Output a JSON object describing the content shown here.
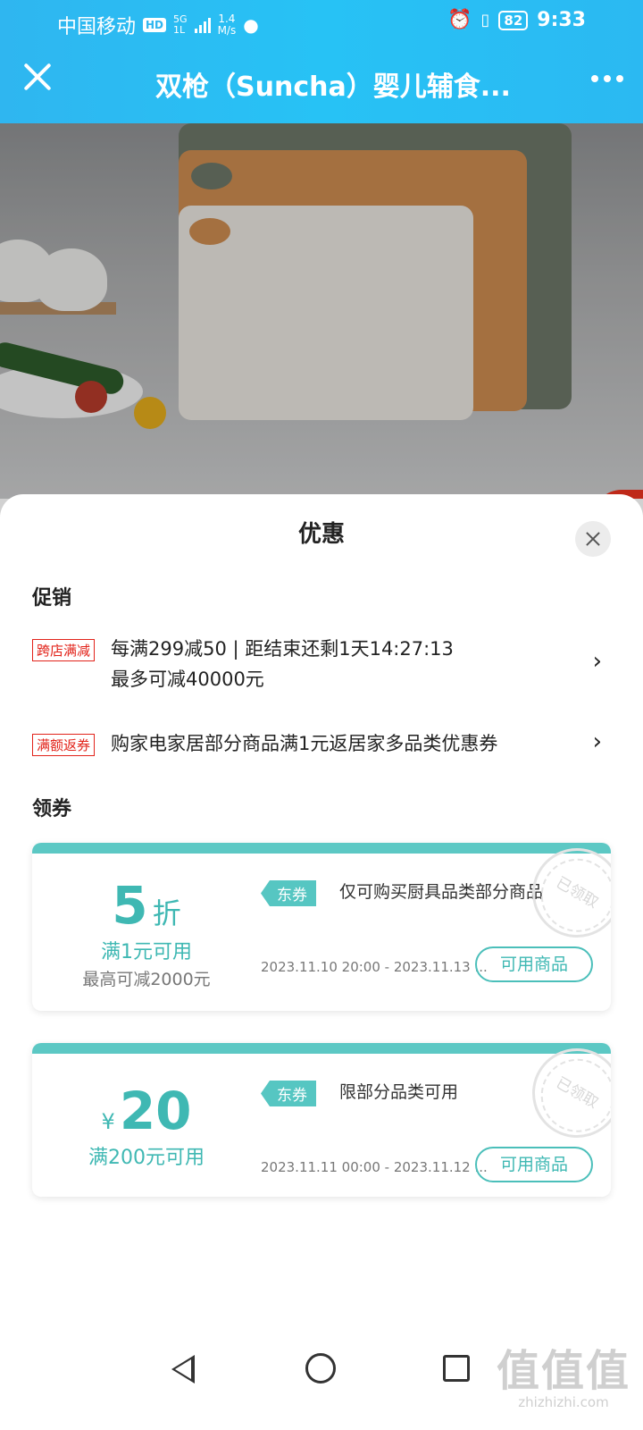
{
  "status_bar": {
    "carrier": "中国移动",
    "hd": "HD",
    "network_top": "5G",
    "network_bottom": "1L",
    "speed_value": "1.4",
    "speed_unit": "M/s",
    "battery": "82",
    "time": "9:33"
  },
  "header": {
    "title": "双枪（Suncha）婴儿辅食..."
  },
  "sheet": {
    "title": "优惠",
    "promotions_label": "促销",
    "promotions": [
      {
        "tag": "跨店满减",
        "line1": "每满299减50 | 距结束还剩1天14:27:13",
        "line2": "最多可减40000元"
      },
      {
        "tag": "满额返券",
        "line1": "购家电家居部分商品满1元返居家多品类优惠券"
      }
    ],
    "coupons_label": "领券",
    "coupons": [
      {
        "value": "5",
        "unit": "折",
        "condition": "满1元可用",
        "max_discount": "最高可减2000元",
        "tag": "东券",
        "description": "仅可购买厨具品类部分商品",
        "date_range": "2023.11.10 20:00 - 2023.11.13 ...",
        "button": "可用商品",
        "stamp": "已领取"
      },
      {
        "currency": "¥",
        "value": "20",
        "condition": "满200元可用",
        "tag": "东券",
        "description": "限部分品类可用",
        "date_range": "2023.11.11 00:00 - 2023.11.12 ...",
        "button": "可用商品",
        "stamp": "已领取"
      }
    ]
  },
  "watermark": {
    "logo": "值值值",
    "domain": "zhizhizhi.com"
  },
  "colors": {
    "header_bg": "#2bb9f2",
    "coupon_accent": "#5cc8c4",
    "promo_tag": "#e2231a"
  }
}
